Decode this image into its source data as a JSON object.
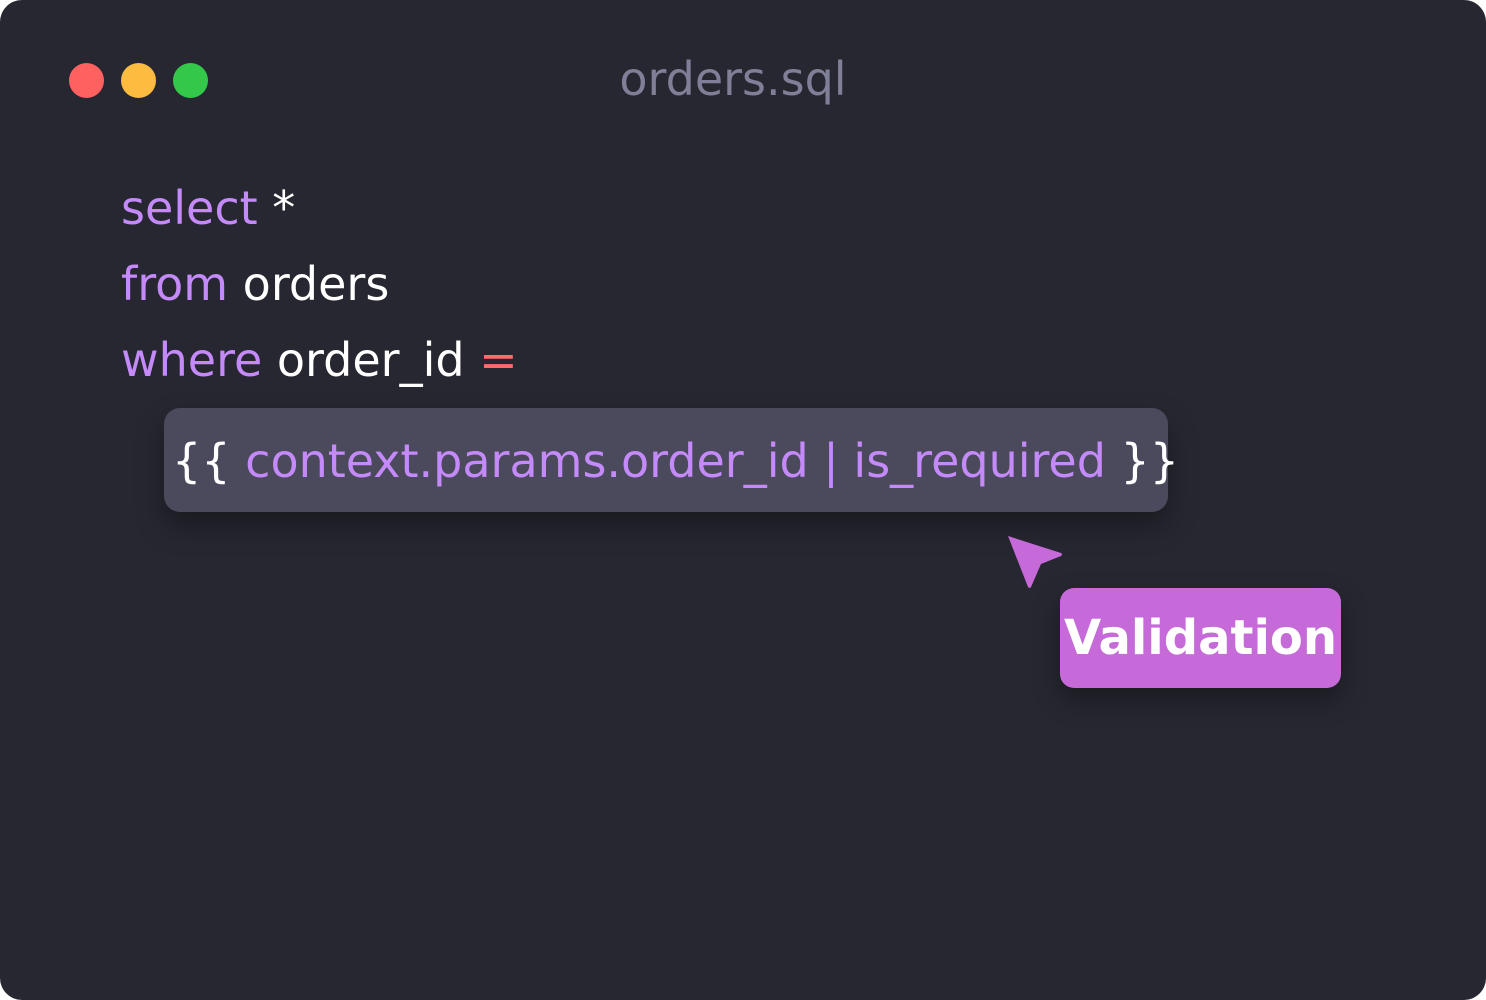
{
  "window": {
    "title": "orders.sql",
    "controls": {
      "close_color": "#ff6161",
      "minimize_color": "#fdbc40",
      "maximize_color": "#34c84a"
    }
  },
  "colors": {
    "background": "#272731",
    "keyword": "#c58af9",
    "identifier": "#ffffff",
    "operator": "#ff6b6b",
    "title": "#7f7f97",
    "template_box": "#4b4a5d",
    "badge": "#c56ad8",
    "cursor": "#c56ad8"
  },
  "code": {
    "line1": {
      "keyword": "select",
      "rest": " *"
    },
    "line2": {
      "keyword": "from",
      "rest": " orders"
    },
    "line3": {
      "keyword": "where",
      "identifier": " order_id ",
      "operator": "="
    },
    "template": {
      "open": "{{ ",
      "expression": "context.params.order_id | is_required",
      "close": " }}"
    }
  },
  "annotation": {
    "cursor_icon": "pointer-arrow-icon",
    "label": "Validation"
  }
}
